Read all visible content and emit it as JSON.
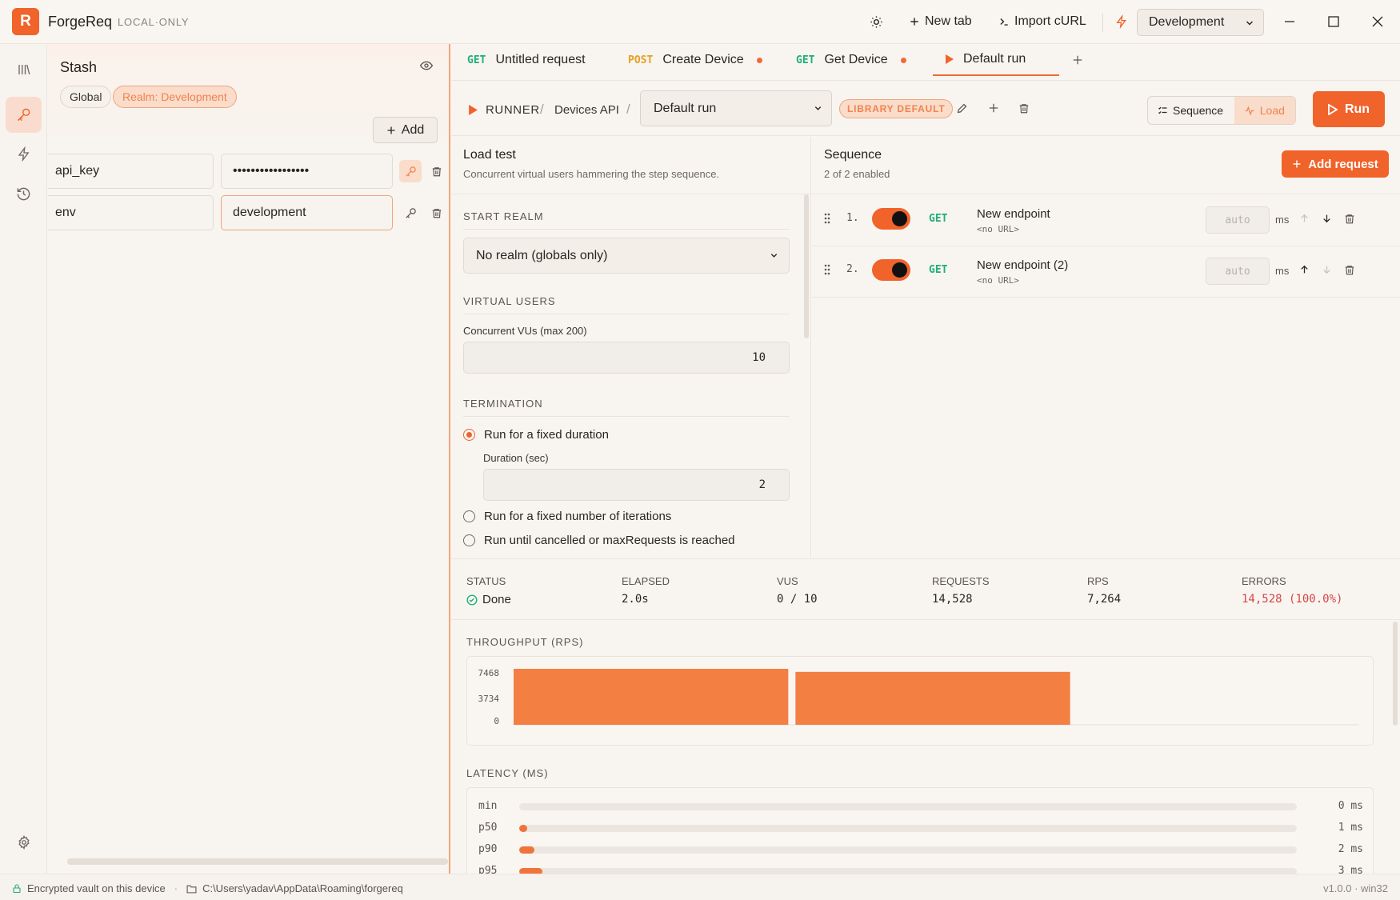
{
  "app": {
    "logo_letter": "R",
    "name": "ForgeReq",
    "mode": "LOCAL·ONLY",
    "accent": "#f0632a"
  },
  "titlebar": {
    "new_tab": "New tab",
    "import_curl": "Import cURL",
    "environment": "Development"
  },
  "stash": {
    "title": "Stash",
    "scopes": [
      "Global",
      "Realm: Development"
    ],
    "add_label": "Add",
    "vars": [
      {
        "key": "api_key",
        "value": "•••••••••••••••••"
      },
      {
        "key": "env",
        "value": "development"
      }
    ]
  },
  "tabs": [
    {
      "method": "GET",
      "label": "Untitled request",
      "dirty": false
    },
    {
      "method": "POST",
      "label": "Create Device",
      "dirty": true
    },
    {
      "method": "GET",
      "label": "Get Device",
      "dirty": true
    },
    {
      "method": "",
      "label": "Default run",
      "dirty": false
    }
  ],
  "runner": {
    "crumbs": [
      "RUNNER",
      "Devices API"
    ],
    "run_name": "Default run",
    "badge": "LIBRARY DEFAULT",
    "modes": [
      "Sequence",
      "Load"
    ],
    "run_label": "Run"
  },
  "load_test": {
    "title": "Load test",
    "subtitle": "Concurrent virtual users hammering the step sequence.",
    "start_realm_label": "START REALM",
    "start_realm_value": "No realm (globals only)",
    "virtual_users_label": "VIRTUAL USERS",
    "concurrent_label": "Concurrent VUs (max 200)",
    "concurrent_value": "10",
    "termination_label": "TERMINATION",
    "opt_duration": "Run for a fixed duration",
    "duration_label": "Duration (sec)",
    "duration_value": "2",
    "opt_iterations": "Run for a fixed number of iterations",
    "opt_until": "Run until cancelled or maxRequests is reached"
  },
  "sequence": {
    "title": "Sequence",
    "subtitle": "2 of 2 enabled",
    "add_label": "Add request",
    "steps": [
      {
        "num": "1.",
        "method": "GET",
        "name": "New endpoint",
        "url": "<no URL>",
        "delay_placeholder": "auto",
        "unit": "ms"
      },
      {
        "num": "2.",
        "method": "GET",
        "name": "New endpoint (2)",
        "url": "<no URL>",
        "delay_placeholder": "auto",
        "unit": "ms"
      }
    ]
  },
  "stats": {
    "status_label": "STATUS",
    "status_value": "Done",
    "elapsed_label": "ELAPSED",
    "elapsed_value": "2.0s",
    "vus_label": "VUS",
    "vus_value": "0 / 10",
    "requests_label": "REQUESTS",
    "requests_value": "14,528",
    "rps_label": "RPS",
    "rps_value": "7,264",
    "errors_label": "ERRORS",
    "errors_value": "14,528 (100.0%)"
  },
  "chart_data": [
    {
      "type": "bar",
      "title": "THROUGHPUT (RPS)",
      "yticks": [
        "7468",
        "3734",
        "0"
      ],
      "ylim": [
        0,
        7468
      ],
      "values": [
        7468,
        7060
      ],
      "slots": 3,
      "color": "#f47f43"
    },
    {
      "type": "bar",
      "title": "LATENCY (MS)",
      "orientation": "horizontal",
      "categories": [
        "min",
        "p50",
        "p90",
        "p95"
      ],
      "values": [
        0,
        1,
        2,
        3
      ],
      "labels": [
        "0 ms",
        "1 ms",
        "2 ms",
        "3 ms"
      ],
      "xlim": [
        0,
        100
      ],
      "color": "#f0743a"
    }
  ],
  "footer": {
    "vault": "Encrypted vault on this device",
    "path": "C:\\Users\\yadav\\AppData\\Roaming\\forgereq",
    "version": "v1.0.0 · win32"
  }
}
